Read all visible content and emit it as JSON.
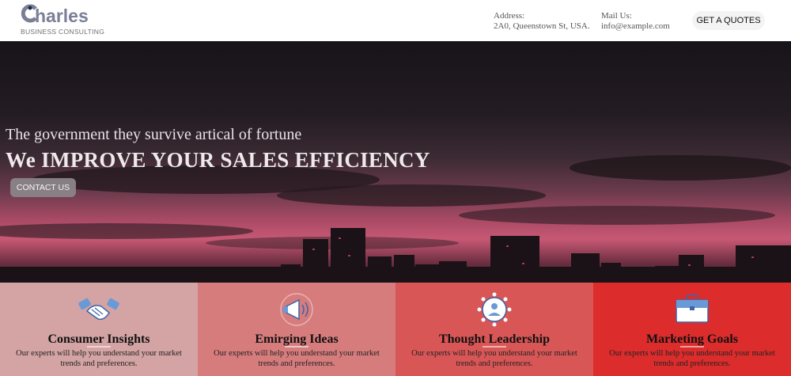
{
  "brand": {
    "name": "harles",
    "initial": "C",
    "tagline": "BUSINESS CONSULTING"
  },
  "header": {
    "address_label": "Address:",
    "address_value": "2A0, Queenstown St, USA.",
    "mail_label": "Mail Us:",
    "mail_value": "info@example.com",
    "cta_label": "GET A QUOTES"
  },
  "hero": {
    "subtitle": "The government they survive artical of fortune",
    "title": "We IMPROVE YOUR SALES EFFICIENCY",
    "button_label": "CONTACT US"
  },
  "features": [
    {
      "title": "Consumer Insights",
      "description": "Our experts will help you understand your market trends and preferences.",
      "icon": "handshake-icon",
      "color": "#d4a3a3"
    },
    {
      "title": "Emirging Ideas",
      "description": "Our experts will help you understand your market trends and preferences.",
      "icon": "megaphone-icon",
      "color": "#d77c7c"
    },
    {
      "title": "Thought Leadership",
      "description": "Our experts will help you understand your market trends and preferences.",
      "icon": "network-user-icon",
      "color": "#d95656"
    },
    {
      "title": "Marketing Goals",
      "description": "Our experts will help you understand your market trends and preferences.",
      "icon": "briefcase-icon",
      "color": "#dc2c2c"
    }
  ],
  "colors": {
    "logo": "#7a7f96",
    "feature_1": "#d4a3a3",
    "feature_2": "#d77c7c",
    "feature_3": "#d95656",
    "feature_4": "#dc2c2c"
  }
}
